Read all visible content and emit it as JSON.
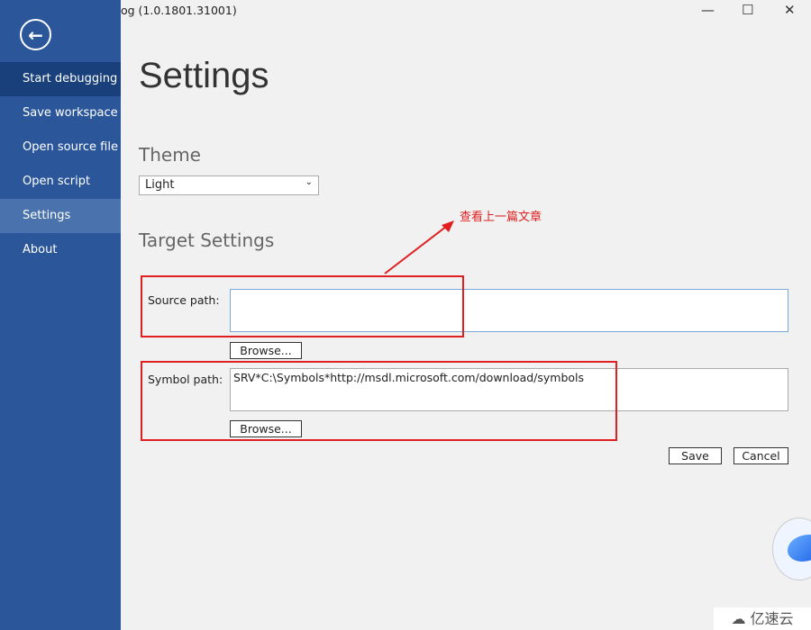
{
  "window": {
    "title": "og (1.0.1801.31001)",
    "minimize": "—",
    "maximize": "☐",
    "close": "✕"
  },
  "sidebar": {
    "back_icon": "arrow-left-circle",
    "items": [
      {
        "label": "Start debugging"
      },
      {
        "label": "Save workspace"
      },
      {
        "label": "Open source file"
      },
      {
        "label": "Open script"
      },
      {
        "label": "Settings",
        "selected": true
      },
      {
        "label": "About"
      }
    ]
  },
  "page": {
    "title": "Settings"
  },
  "theme": {
    "heading": "Theme",
    "value": "Light"
  },
  "target": {
    "heading": "Target Settings",
    "source_label": "Source path:",
    "source_value": "",
    "source_browse": "Browse...",
    "symbol_label": "Symbol path:",
    "symbol_value": "SRV*C:\\Symbols*http://msdl.microsoft.com/download/symbols",
    "symbol_browse": "Browse..."
  },
  "actions": {
    "save": "Save",
    "cancel": "Cancel"
  },
  "annotation": {
    "text": "查看上一篇文章",
    "color": "#e02020"
  },
  "watermark": {
    "text": "亿速云"
  },
  "colors": {
    "sidebar": "#2b579a",
    "sidebar_active": "#19407a",
    "sidebar_selected": "#4a72ad"
  }
}
